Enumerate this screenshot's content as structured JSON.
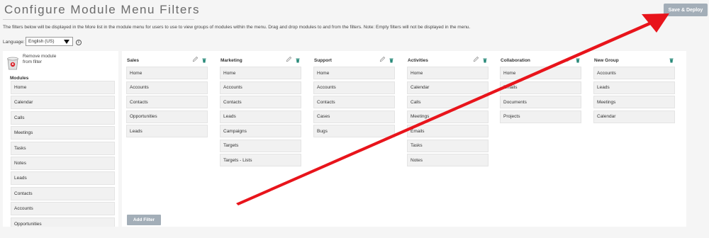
{
  "header": {
    "title": "Configure Module Menu Filters",
    "save_deploy_label": "Save & Deploy"
  },
  "description": "The filters below will be displayed in the More list in the module menu for users to use to view groups of modules within the menu. Drag and drop modules to and from the filters. Note: Empty filters will not be displayed in the menu.",
  "language": {
    "label": "Language:",
    "selected": "English (US)",
    "info_icon": "info-icon"
  },
  "modules_panel": {
    "remove_label_line1": "Remove module",
    "remove_label_line2": "from filter",
    "title": "Modules",
    "items": [
      "Home",
      "Calendar",
      "Calls",
      "Meetings",
      "Tasks",
      "Notes",
      "Leads",
      "Contacts",
      "Accounts",
      "Opportunities"
    ]
  },
  "groups": [
    {
      "name": "Sales",
      "items": [
        "Home",
        "Accounts",
        "Contacts",
        "Opportunities",
        "Leads"
      ]
    },
    {
      "name": "Marketing",
      "items": [
        "Home",
        "Accounts",
        "Contacts",
        "Leads",
        "Campaigns",
        "Targets",
        "Targets - Lists"
      ]
    },
    {
      "name": "Support",
      "items": [
        "Home",
        "Accounts",
        "Contacts",
        "Cases",
        "Bugs"
      ]
    },
    {
      "name": "Activities",
      "items": [
        "Home",
        "Calendar",
        "Calls",
        "Meetings",
        "Emails",
        "Tasks",
        "Notes"
      ]
    },
    {
      "name": "Collaboration",
      "items": [
        "Home",
        "Emails",
        "Documents",
        "Projects"
      ]
    },
    {
      "name": "New Group",
      "items": [
        "Accounts",
        "Leads",
        "Meetings",
        "Calendar"
      ]
    }
  ],
  "add_filter_label": "Add Filter",
  "colors": {
    "button_bg": "#a3aeb8",
    "arrow": "#e8141b",
    "delete_icon": "#2a8a7a"
  }
}
